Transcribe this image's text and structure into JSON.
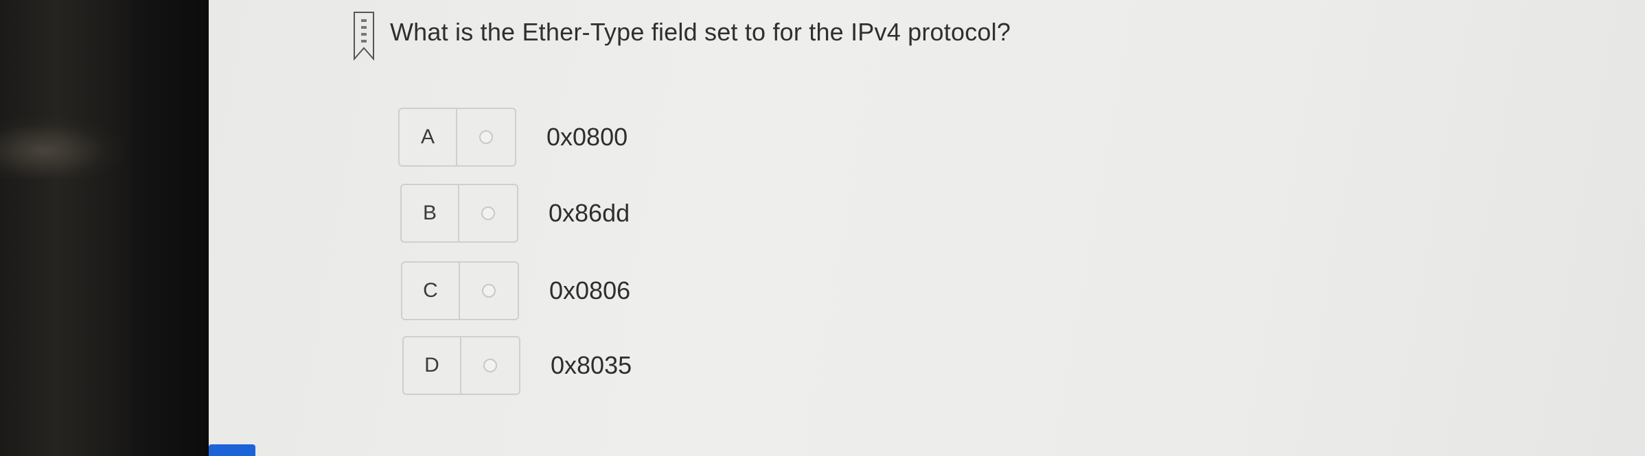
{
  "question": {
    "text": "What is the Ether-Type field set to for the IPv4 protocol?",
    "bookmark_icon": "bookmark-icon"
  },
  "options": [
    {
      "letter": "A",
      "text": "0x0800"
    },
    {
      "letter": "B",
      "text": "0x86dd"
    },
    {
      "letter": "C",
      "text": "0x0806"
    },
    {
      "letter": "D",
      "text": "0x8035"
    }
  ],
  "colors": {
    "screen_bg": "#ececea",
    "text": "#2f2f2f",
    "taskbar_accent": "#1d63d8"
  }
}
